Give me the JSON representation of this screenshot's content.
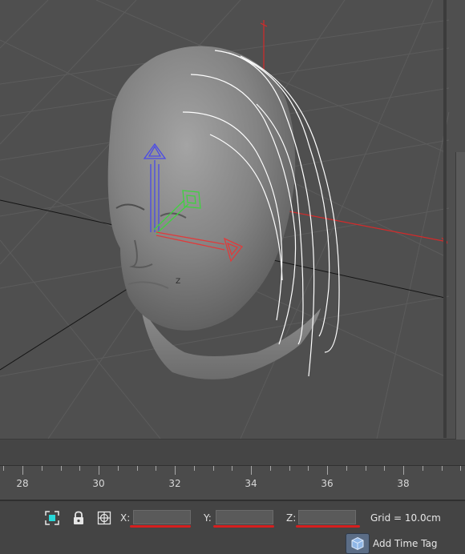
{
  "viewport": {
    "gizmo_axis_labels": [
      "Z",
      "Y",
      "X"
    ]
  },
  "timeline": {
    "ticks": [
      "28",
      "30",
      "32",
      "34",
      "36",
      "38"
    ]
  },
  "statusbar": {
    "x_label": "X:",
    "y_label": "Y:",
    "z_label": "Z:",
    "x_value": "",
    "y_value": "",
    "z_value": "",
    "grid_text": "Grid = 10.0cm",
    "add_time_tag_label": "Add Time Tag"
  },
  "icons": {
    "selection": "selection-lock-toggle-icon",
    "lock": "lock-icon",
    "transform_mode": "absolute-relative-mode-icon",
    "time_tag": "time-tag-cube-icon"
  },
  "colors": {
    "viewport_bg": "#4f4f4f",
    "grid_line": "#5c5c5c",
    "world_axis": "#151515",
    "head": "#8a8a8a",
    "hair": "#ffffff",
    "gizmo_x": "#e03b3b",
    "gizmo_y": "#3fd23f",
    "gizmo_z": "#4a4ae8",
    "red_underline": "#d61f1f",
    "selected_object": "#d42a2a"
  }
}
